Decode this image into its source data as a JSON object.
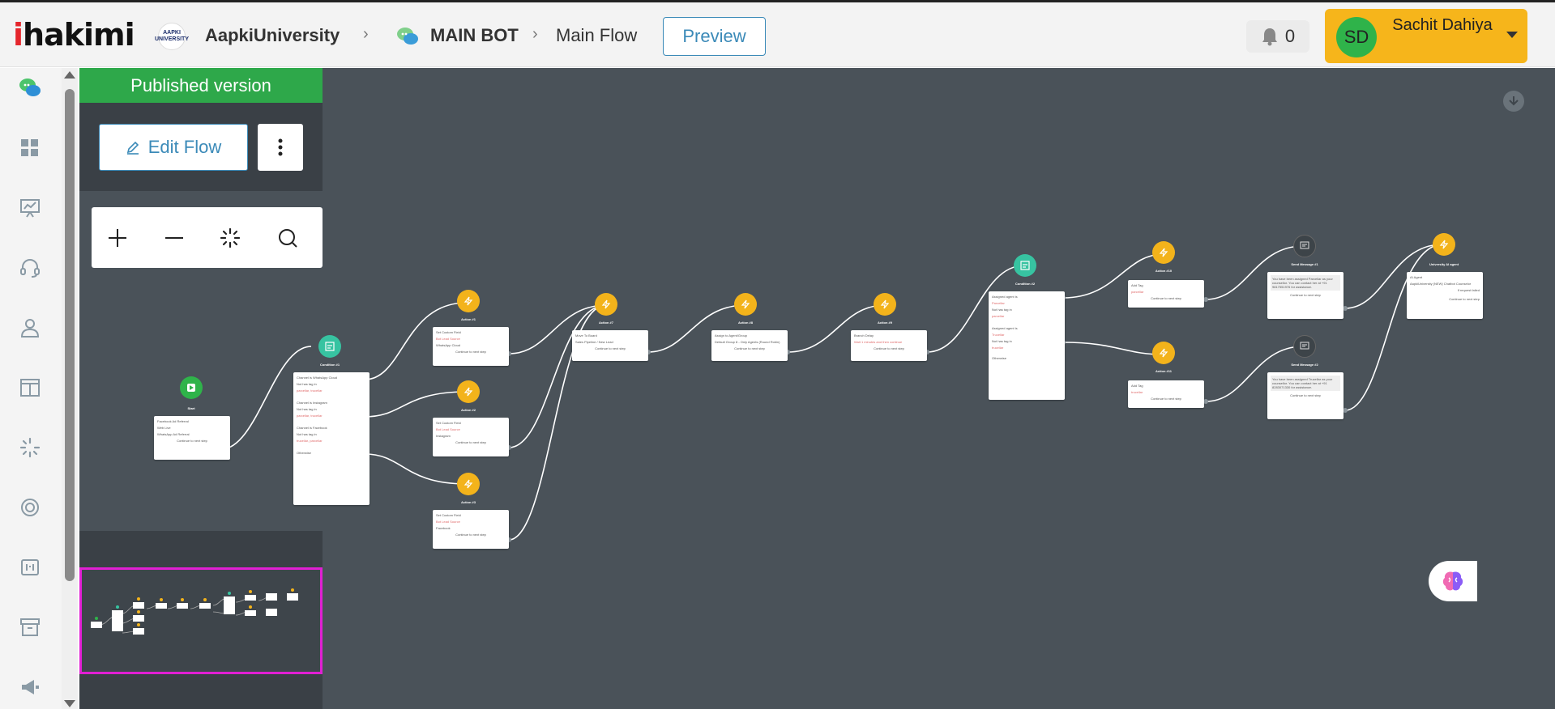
{
  "header": {
    "logo_prefix": "i",
    "logo_text": "hakimi",
    "org_logo_text": "AAPKI UNIVERSITY",
    "org_name": "AapkiUniversity",
    "bot_name": "MAIN BOT",
    "flow_name": "Main Flow",
    "preview_label": "Preview",
    "notification_count": "0",
    "user_initials": "SD",
    "user_name": "Sachit Dahiya"
  },
  "sidebar": {
    "icons": [
      "chat-bubbles-icon",
      "dashboard-grid-icon",
      "presentation-chart-icon",
      "headset-icon",
      "user-icon",
      "layout-columns-icon",
      "sparkle-loader-icon",
      "lifebuoy-icon",
      "list-number-icon",
      "archive-icon",
      "megaphone-icon"
    ]
  },
  "panel": {
    "published_label": "Published version",
    "edit_flow_label": "Edit Flow"
  },
  "nodes": {
    "start": {
      "title": "Start",
      "lines": [
        "Facebook Ad Referral",
        "Web Live",
        "WhatsApp Ad Referral"
      ],
      "footer": "Continue to next step"
    },
    "cond1": {
      "title": "Condition #1",
      "lines": [
        "Channel is WhatsApp Cloud",
        "Not has tag in",
        "parcellar, trucellar",
        "Channel is Instagram",
        "Not has tag in",
        "parcellar, trucellar",
        "Channel is Facebook",
        "Not has tag in",
        "trucellar, parcellar",
        "Otherwise"
      ]
    },
    "a1": {
      "title": "Action #1",
      "lines": [
        "Set Custom Field",
        "Bot Lead Source",
        "WhatsApp Cloud"
      ],
      "footer": "Continue to next step"
    },
    "a2": {
      "title": "Action #2",
      "lines": [
        "Set Custom Field",
        "Bot Lead Source",
        "Instagram"
      ],
      "footer": "Continue to next step"
    },
    "a3": {
      "title": "Action #3",
      "lines": [
        "Set Custom Field",
        "Bot Lead Source",
        "Facebook"
      ],
      "footer": "Continue to next step"
    },
    "a7": {
      "title": "Action #7",
      "lines": [
        "Move To Board",
        "Sales Pipeline / New Lead"
      ],
      "footer": "Continue to next step"
    },
    "a8": {
      "title": "Action #8",
      "lines": [
        "Assign to Agent/Group",
        "Default Group 8 - Only Agents (Round Robin)"
      ],
      "footer": "Continue to next step"
    },
    "a9": {
      "title": "Action #9",
      "lines": [
        "Branch Delay",
        "Wait 1 minutes and then continue"
      ],
      "footer": "Continue to next step"
    },
    "cond2": {
      "title": "Condition #2",
      "lines": [
        "Assigned agent is",
        "Parcellar",
        "Not has tag in",
        "parcellar",
        "Assigned agent is",
        "Trucellar",
        "Not has tag in",
        "trucellar",
        "Otherwise"
      ]
    },
    "a10": {
      "title": "Action #10",
      "lines": [
        "Add Tag",
        "parcellar"
      ],
      "footer": "Continue to next step"
    },
    "a11": {
      "title": "Action #11",
      "lines": [
        "Add Tag",
        "trucellar"
      ],
      "footer": "Continue to next step"
    },
    "m1": {
      "title": "Send Message #1",
      "lines": [
        "You have been assigned Parcellar as your counsellor. You can contact her at +91 9817551976 for assistance."
      ],
      "footer": "Continue to next step"
    },
    "m2": {
      "title": "Send Message #2",
      "lines": [
        "You have been assigned Trucellar as your counsellor. You can contact her at +91 8283071330 for assistance."
      ],
      "footer": "Continue to next step"
    },
    "ai": {
      "title": "University AI agent",
      "lines": [
        "AI Agent",
        "AapkiUniversity (NEW) Chatbot Counselor",
        "If request failed"
      ],
      "footer": "Continue to next step"
    }
  }
}
